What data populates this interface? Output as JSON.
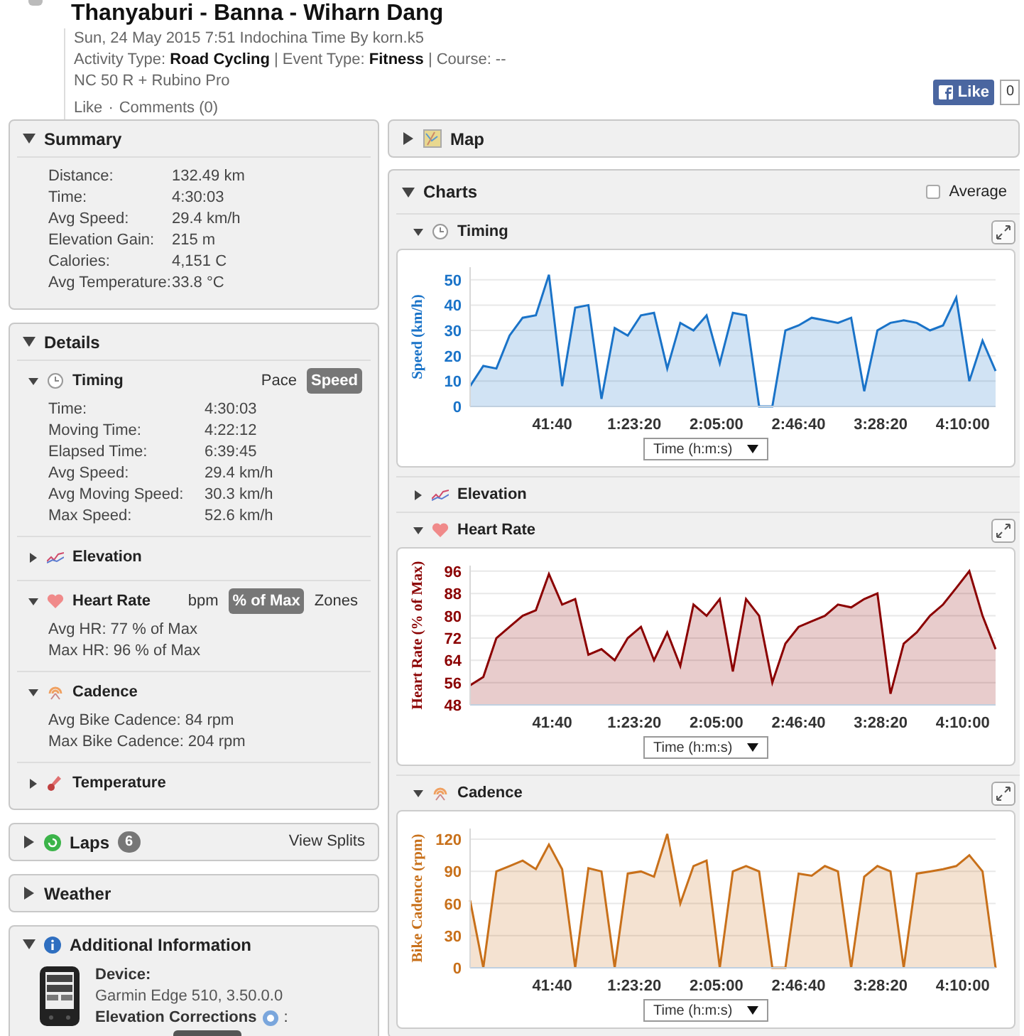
{
  "header": {
    "title": "Thanyaburi - Banna - Wiharn Dang",
    "date_line": "Sun, 24 May 2015 7:51 Indochina Time By",
    "author": "korn.k5",
    "activity_line": "Activity Type: **Road Cycling** | Event Type: **Fitness** | Course: --",
    "equipment": "NC 50 R + Rubino Pro",
    "like": "Like",
    "separator": "·",
    "comments": "Comments (0)"
  },
  "facebook": {
    "label": "Like",
    "count": "0"
  },
  "summary": {
    "title": "Summary",
    "expanded": true,
    "rows": [
      {
        "label": "Distance:",
        "value": "132.49 km"
      },
      {
        "label": "Time:",
        "value": "4:30:03"
      },
      {
        "label": "Avg Speed:",
        "value": "29.4 km/h"
      },
      {
        "label": "Elevation Gain:",
        "value": "215 m"
      },
      {
        "label": "Calories:",
        "value": "4,151 C"
      },
      {
        "label": "Avg Temperature:",
        "value": "33.8 °C"
      }
    ]
  },
  "details": {
    "title": "Details",
    "expanded": true,
    "sections": [
      {
        "kind": "timing",
        "title": "Timing",
        "expanded": true,
        "toggles": [
          {
            "label": "Pace",
            "selected": false
          },
          {
            "label": "Speed",
            "selected": true
          }
        ],
        "rows": [
          {
            "label": "Time:",
            "value": "4:30:03"
          },
          {
            "label": "Moving Time:",
            "value": "4:22:12"
          },
          {
            "label": "Elapsed Time:",
            "value": "6:39:45"
          },
          {
            "label": "Avg Speed:",
            "value": "29.4 km/h"
          },
          {
            "label": "Avg Moving Speed:",
            "value": "30.3 km/h"
          },
          {
            "label": "Max Speed:",
            "value": "52.6 km/h"
          }
        ]
      },
      {
        "kind": "elevation",
        "title": "Elevation",
        "expanded": false
      },
      {
        "kind": "heart_rate",
        "title": "Heart Rate",
        "expanded": true,
        "toggles": [
          {
            "label": "bpm",
            "selected": false
          },
          {
            "label": "% of Max",
            "selected": true
          },
          {
            "label": "Zones",
            "selected": false
          }
        ],
        "rows": [
          {
            "label": "Avg HR:",
            "value": "77 % of Max"
          },
          {
            "label": "Max HR:",
            "value": "96 % of Max"
          }
        ]
      },
      {
        "kind": "cadence",
        "title": "Cadence",
        "expanded": true,
        "rows": [
          {
            "label": "Avg Bike Cadence:",
            "value": "84 rpm"
          },
          {
            "label": "Max Bike Cadence:",
            "value": "204 rpm"
          }
        ]
      },
      {
        "kind": "temperature",
        "title": "Temperature",
        "expanded": false
      }
    ]
  },
  "laps": {
    "title": "Laps",
    "count": "6",
    "expanded": false,
    "link": "View Splits"
  },
  "weather": {
    "title": "Weather",
    "expanded": false
  },
  "additional": {
    "title": "Additional Information",
    "expanded": true,
    "device_label": "Device:",
    "device": "Garmin Edge 510, 3.50.0.0",
    "corrections_label": "Elevation Corrections",
    "corrections_colon": ":"
  },
  "map": {
    "title": "Map",
    "expanded": false
  },
  "charts": {
    "title": "Charts",
    "expanded": true,
    "average": {
      "label": "Average",
      "checked": false
    },
    "panels": [
      {
        "kind": "timing",
        "title": "Timing",
        "expanded": true,
        "axis_select": "Time (h:m:s)",
        "chart_data": {
          "type": "area",
          "ylabel": "Speed (km/h)",
          "x": [
            0,
            400,
            800,
            1200,
            1600,
            2000,
            2400,
            2800,
            3200,
            3600,
            4000,
            4400,
            4800,
            5200,
            5600,
            6000,
            6400,
            6800,
            7200,
            7600,
            8000,
            8400,
            8800,
            9200,
            9600,
            10000,
            10400,
            10800,
            11200,
            11600,
            12000,
            12400,
            12800,
            13200,
            13600,
            14000,
            14400,
            14800,
            15200,
            15600,
            16000
          ],
          "xlim": [
            0,
            16000
          ],
          "ylim": [
            0,
            55
          ],
          "xticks": [
            {
              "value": 2500,
              "label": "41:40"
            },
            {
              "value": 5000,
              "label": "1:23:20"
            },
            {
              "value": 7500,
              "label": "2:05:00"
            },
            {
              "value": 10000,
              "label": "2:46:40"
            },
            {
              "value": 12500,
              "label": "3:28:20"
            },
            {
              "value": 15000,
              "label": "4:10:00"
            }
          ],
          "yticks": [
            0,
            10,
            20,
            30,
            40,
            50
          ],
          "grid": true,
          "series": [
            {
              "color": "#1a73c8",
              "values": [
                8,
                16,
                15,
                28,
                35,
                36,
                52,
                8,
                39,
                40,
                3,
                31,
                28,
                36,
                37,
                15,
                33,
                30,
                36,
                17,
                37,
                36,
                0,
                0,
                30,
                32,
                35,
                34,
                33,
                35,
                6,
                30,
                33,
                34,
                33,
                30,
                32,
                43,
                10,
                26,
                14
              ]
            }
          ]
        }
      },
      {
        "kind": "elevation",
        "title": "Elevation",
        "expanded": false
      },
      {
        "kind": "heart_rate",
        "title": "Heart Rate",
        "expanded": true,
        "axis_select": "Time (h:m:s)",
        "chart_data": {
          "type": "area",
          "ylabel": "Heart Rate (% of Max)",
          "x": [
            0,
            400,
            800,
            1200,
            1600,
            2000,
            2400,
            2800,
            3200,
            3600,
            4000,
            4400,
            4800,
            5200,
            5600,
            6000,
            6400,
            6800,
            7200,
            7600,
            8000,
            8400,
            8800,
            9200,
            9600,
            10000,
            10400,
            10800,
            11200,
            11600,
            12000,
            12400,
            12800,
            13200,
            13600,
            14000,
            14400,
            14800,
            15200,
            15600,
            16000
          ],
          "xlim": [
            0,
            16000
          ],
          "ylim": [
            48,
            98
          ],
          "xticks": [
            {
              "value": 2500,
              "label": "41:40"
            },
            {
              "value": 5000,
              "label": "1:23:20"
            },
            {
              "value": 7500,
              "label": "2:05:00"
            },
            {
              "value": 10000,
              "label": "2:46:40"
            },
            {
              "value": 12500,
              "label": "3:28:20"
            },
            {
              "value": 15000,
              "label": "4:10:00"
            }
          ],
          "yticks": [
            48,
            56,
            64,
            72,
            80,
            88,
            96
          ],
          "grid": true,
          "series": [
            {
              "color": "#8b0000",
              "values": [
                55,
                58,
                72,
                76,
                80,
                82,
                95,
                84,
                86,
                66,
                68,
                64,
                72,
                76,
                64,
                74,
                62,
                84,
                80,
                86,
                60,
                86,
                80,
                56,
                70,
                76,
                78,
                80,
                84,
                83,
                86,
                88,
                52,
                70,
                74,
                80,
                84,
                90,
                96,
                80,
                68
              ]
            }
          ]
        }
      },
      {
        "kind": "cadence",
        "title": "Cadence",
        "expanded": true,
        "axis_select": "Time (h:m:s)",
        "chart_data": {
          "type": "area",
          "ylabel": "Bike Cadence (rpm)",
          "x": [
            0,
            400,
            800,
            1200,
            1600,
            2000,
            2400,
            2800,
            3200,
            3600,
            4000,
            4400,
            4800,
            5200,
            5600,
            6000,
            6400,
            6800,
            7200,
            7600,
            8000,
            8400,
            8800,
            9200,
            9600,
            10000,
            10400,
            10800,
            11200,
            11600,
            12000,
            12400,
            12800,
            13200,
            13600,
            14000,
            14400,
            14800,
            15200,
            15600,
            16000
          ],
          "xlim": [
            0,
            16000
          ],
          "ylim": [
            0,
            130
          ],
          "xticks": [
            {
              "value": 2500,
              "label": "41:40"
            },
            {
              "value": 5000,
              "label": "1:23:20"
            },
            {
              "value": 7500,
              "label": "2:05:00"
            },
            {
              "value": 10000,
              "label": "2:46:40"
            },
            {
              "value": 12500,
              "label": "3:28:20"
            },
            {
              "value": 15000,
              "label": "4:10:00"
            }
          ],
          "yticks": [
            0,
            30,
            60,
            90,
            120
          ],
          "grid": true,
          "series": [
            {
              "color": "#c8701a",
              "values": [
                63,
                0,
                90,
                95,
                100,
                92,
                115,
                92,
                0,
                93,
                90,
                0,
                88,
                90,
                85,
                125,
                60,
                95,
                100,
                0,
                90,
                95,
                90,
                0,
                0,
                88,
                86,
                95,
                90,
                0,
                85,
                95,
                90,
                0,
                88,
                90,
                92,
                95,
                105,
                90,
                0
              ]
            }
          ]
        }
      }
    ]
  }
}
